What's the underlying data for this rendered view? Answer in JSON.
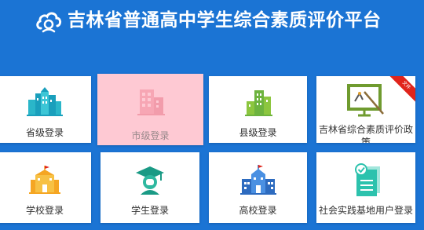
{
  "header": {
    "title": "吉林省普通高中学生综合素质评价平台"
  },
  "cards": [
    {
      "label": "省级登录"
    },
    {
      "label": "市级登录"
    },
    {
      "label": "县级登录"
    },
    {
      "label": "吉林省综合素质评价政策",
      "label_line1": "吉林省综合素质评价政",
      "label_line2": "策",
      "ribbon": "文件"
    },
    {
      "label": "学校登录"
    },
    {
      "label": "学生登录"
    },
    {
      "label": "高校登录"
    },
    {
      "label": "社会实践基地用户登录"
    }
  ],
  "colors": {
    "background": "#1b74d4",
    "active_card": "#fec9d3",
    "ribbon": "#e0241b"
  },
  "icons": [
    "cloud-logo-icon",
    "city-buildings-icon",
    "office-tower-icon",
    "green-buildings-icon",
    "policy-board-icon",
    "school-building-icon",
    "graduate-cap-icon",
    "university-building-icon",
    "certificate-documents-icon"
  ]
}
